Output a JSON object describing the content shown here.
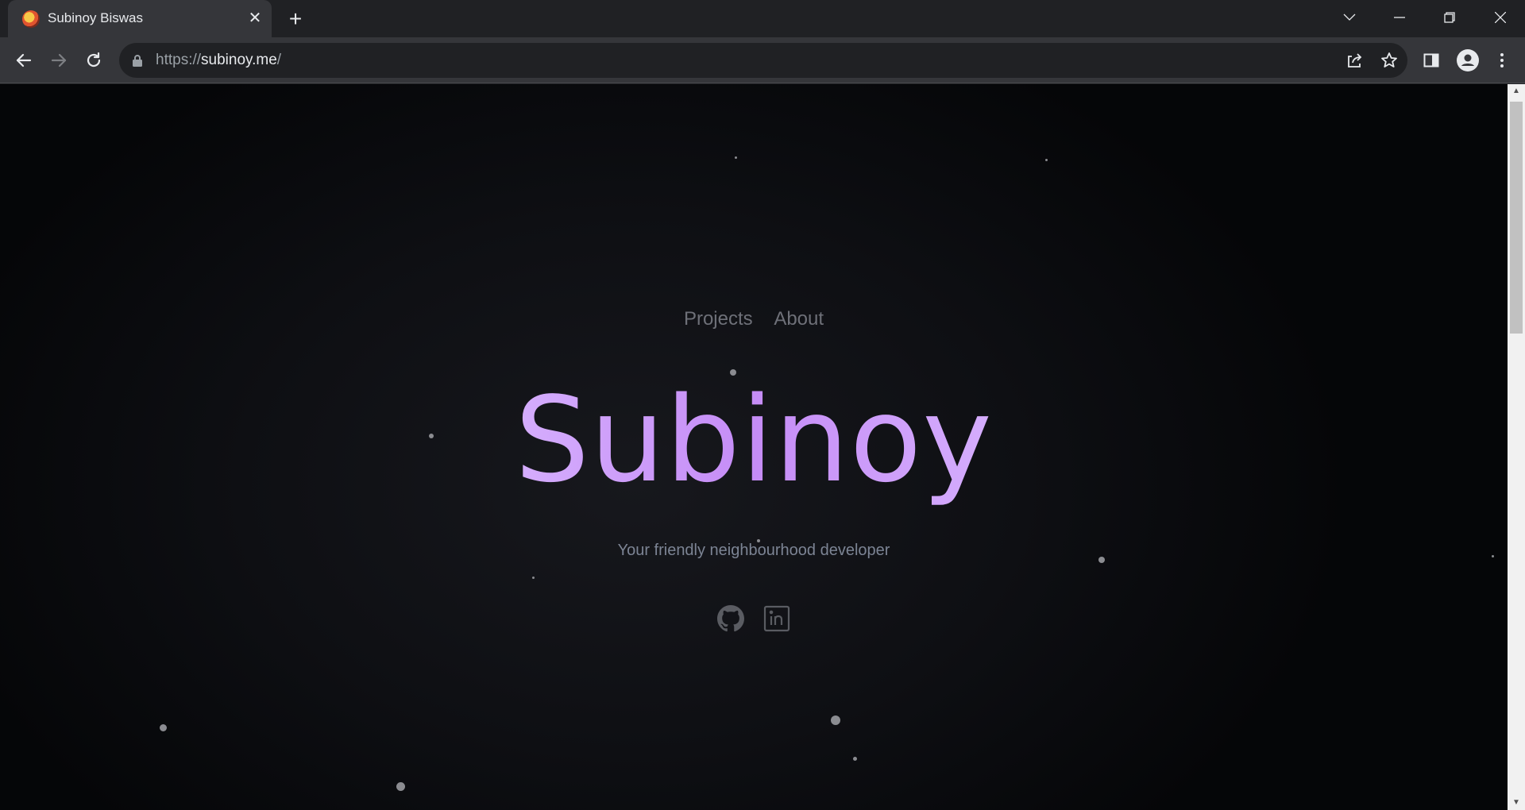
{
  "browser": {
    "tab": {
      "title": "Subinoy Biswas",
      "favicon": "site-favicon-icon"
    },
    "url": {
      "scheme": "https://",
      "host": "subinoy.me",
      "path": "/"
    },
    "icons": [
      "back-icon",
      "forward-icon",
      "reload-icon",
      "lock-icon",
      "share-icon",
      "bookmark-star-icon",
      "side-panel-icon",
      "profile-icon",
      "menu-icon",
      "tab-search-icon",
      "minimize-icon",
      "restore-icon",
      "close-icon"
    ]
  },
  "page": {
    "nav": [
      {
        "label": "Projects"
      },
      {
        "label": "About"
      }
    ],
    "hero_title": "Subinoy",
    "tagline": "Your friendly neighbourhood developer",
    "socials": [
      {
        "icon": "github-icon"
      },
      {
        "icon": "linkedin-icon"
      }
    ],
    "colors": {
      "background": "#0b0c0f",
      "hero_gradient_start": "#e6d4ff",
      "hero_gradient_mid": "#c58cf6",
      "nav_text": "#6e7078",
      "tagline_text": "#7c8494"
    }
  }
}
